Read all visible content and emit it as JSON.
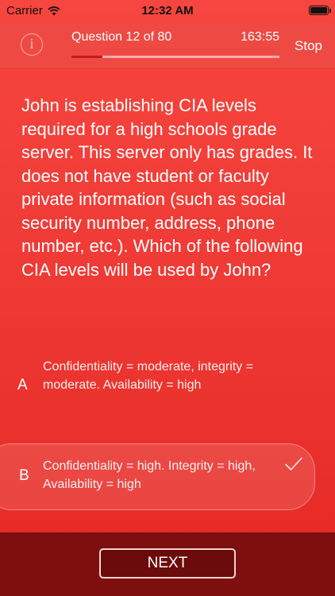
{
  "status_bar": {
    "carrier": "Carrier",
    "time": "12:32 AM",
    "wifi_icon": "wifi-icon",
    "battery_icon": "battery-icon",
    "battery_level": 1.0
  },
  "header": {
    "info_label": "i",
    "question_counter": "Question 12 of 80",
    "timer": "163:55",
    "stop_label": "Stop",
    "progress": 0.15
  },
  "question": {
    "text": "John is establishing CIA levels required for a high schools grade server. This server only has grades. It does not have student or faculty private information (such as social security number, address, phone number, etc.). Which of the following CIA levels will be used by John?"
  },
  "answers": [
    {
      "letter": "A",
      "text": "Confidentiality = moderate, integrity = moderate. Availability = high",
      "selected": false
    },
    {
      "letter": "B",
      "text": "Confidentiality = high. Integrity = high, Availability = high",
      "selected": true,
      "icon": "checkmark-icon"
    }
  ],
  "footer": {
    "next_label": "NEXT"
  },
  "colors": {
    "background": "#ef3a35",
    "header": "#ee4a43",
    "footer": "#7d0f0f",
    "progress_fill": "#c71b1b"
  }
}
